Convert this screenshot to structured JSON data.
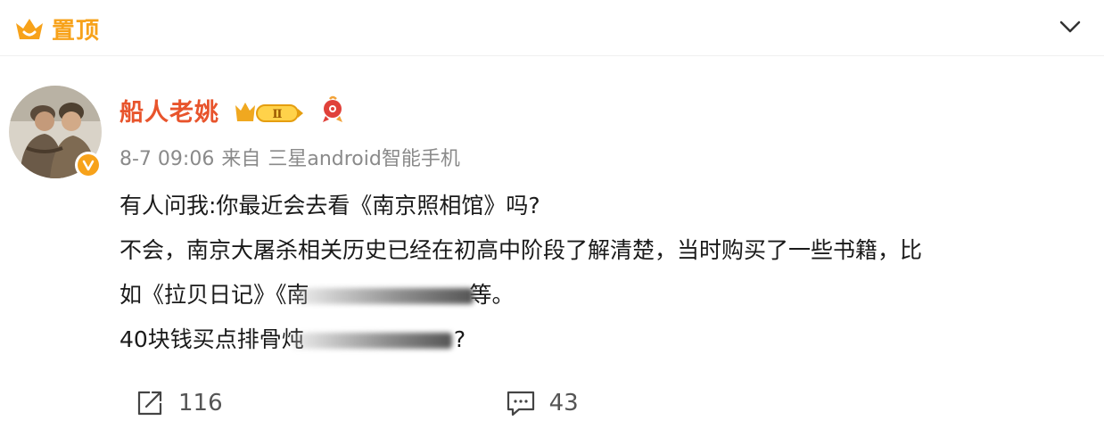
{
  "header": {
    "pin_label": "置顶",
    "pin_color": "#f7a21a"
  },
  "author": {
    "name": "船人老姚",
    "name_color": "#e8542c",
    "vip_level": "Ⅱ"
  },
  "meta": {
    "date": "8-7 09:06",
    "source_prefix": "来自",
    "source": "三星android智能手机"
  },
  "post": {
    "line1": "有人问我:你最近会去看《南京照相馆》吗?",
    "line2": "不会，南京大屠杀相关历史已经在初高中阶段了解清楚，当时购买了一些书籍，比",
    "line3_start": "如《拉贝日记》《南",
    "line3_end": "等。",
    "line4_start": "40块钱买点排骨炖",
    "line4_end": "?"
  },
  "actions": {
    "repost_count": "116",
    "comment_count": "43"
  },
  "icons": {
    "pin": "crown-pin-icon",
    "expand": "chevron-down-icon",
    "repost": "repost-icon",
    "comment": "comment-icon"
  }
}
